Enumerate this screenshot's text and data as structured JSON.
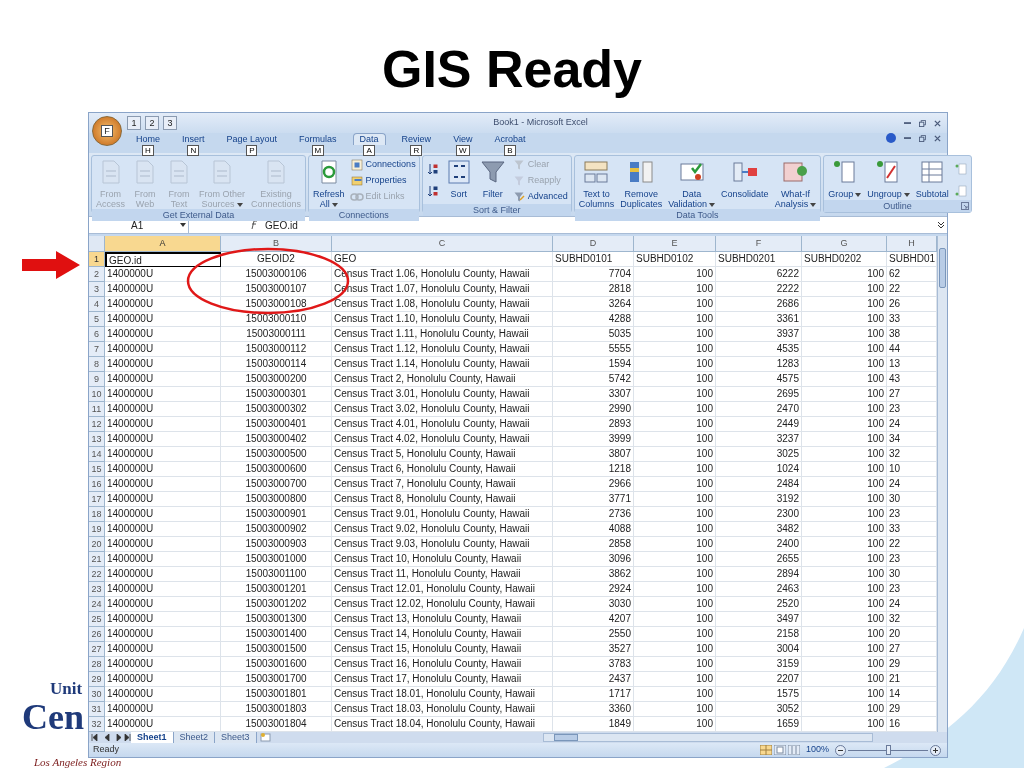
{
  "slide": {
    "title": "GIS Ready",
    "logo": {
      "line_1": "Unit",
      "line_2": "Cen",
      "region": "Los Angeles Region"
    }
  },
  "window": {
    "title": "Book1 - Microsoft Excel",
    "office_key": "F",
    "quick_access_keys": [
      "1",
      "2",
      "3"
    ]
  },
  "tabs": [
    {
      "label": "Home",
      "key": "H",
      "selected": false
    },
    {
      "label": "Insert",
      "key": "N",
      "selected": false
    },
    {
      "label": "Page Layout",
      "key": "P",
      "selected": false
    },
    {
      "label": "Formulas",
      "key": "M",
      "selected": false
    },
    {
      "label": "Data",
      "key": "A",
      "selected": true
    },
    {
      "label": "Review",
      "key": "R",
      "selected": false
    },
    {
      "label": "View",
      "key": "W",
      "selected": false
    },
    {
      "label": "Acrobat",
      "key": "B",
      "selected": false
    }
  ],
  "ribbon_groups": [
    {
      "name": "Get External Data",
      "launcher": false,
      "items": [
        {
          "kind": "large",
          "lines": [
            "From",
            "Access"
          ],
          "disabled": true,
          "caret": false
        },
        {
          "kind": "large",
          "lines": [
            "From",
            "Web"
          ],
          "disabled": true,
          "caret": false
        },
        {
          "kind": "large",
          "lines": [
            "From",
            "Text"
          ],
          "disabled": true,
          "caret": false
        },
        {
          "kind": "large",
          "lines": [
            "From Other",
            "Sources"
          ],
          "disabled": true,
          "caret": true
        },
        {
          "kind": "large",
          "lines": [
            "Existing",
            "Connections"
          ],
          "disabled": true,
          "caret": false
        }
      ]
    },
    {
      "name": "Connections",
      "launcher": false,
      "items": [
        {
          "kind": "large",
          "lines": [
            "Refresh",
            "All"
          ],
          "disabled": false,
          "caret": true
        },
        {
          "kind": "stack",
          "items": [
            {
              "label": "Connections",
              "disabled": false
            },
            {
              "label": "Properties",
              "disabled": false
            },
            {
              "label": "Edit Links",
              "disabled": true
            }
          ]
        }
      ]
    },
    {
      "name": "Sort & Filter",
      "launcher": false,
      "items": [
        {
          "kind": "iconstack"
        },
        {
          "kind": "large",
          "lines": [
            "Sort"
          ],
          "disabled": false,
          "caret": false
        },
        {
          "kind": "large",
          "lines": [
            "Filter"
          ],
          "disabled": false,
          "caret": false
        },
        {
          "kind": "stack",
          "items": [
            {
              "label": "Clear",
              "disabled": true
            },
            {
              "label": "Reapply",
              "disabled": true
            },
            {
              "label": "Advanced",
              "disabled": false
            }
          ]
        }
      ]
    },
    {
      "name": "Data Tools",
      "launcher": false,
      "items": [
        {
          "kind": "large",
          "lines": [
            "Text to",
            "Columns"
          ],
          "disabled": false,
          "caret": false
        },
        {
          "kind": "large",
          "lines": [
            "Remove",
            "Duplicates"
          ],
          "disabled": false,
          "caret": false
        },
        {
          "kind": "large",
          "lines": [
            "Data",
            "Validation"
          ],
          "disabled": false,
          "caret": true
        },
        {
          "kind": "large",
          "lines": [
            "Consolidate"
          ],
          "disabled": false,
          "caret": false
        },
        {
          "kind": "large",
          "lines": [
            "What-If",
            "Analysis"
          ],
          "disabled": false,
          "caret": true
        }
      ]
    },
    {
      "name": "Outline",
      "launcher": true,
      "items": [
        {
          "kind": "large",
          "lines": [
            "Group"
          ],
          "disabled": false,
          "caret": true
        },
        {
          "kind": "large",
          "lines": [
            "Ungroup"
          ],
          "disabled": false,
          "caret": true
        },
        {
          "kind": "large",
          "lines": [
            "Subtotal"
          ],
          "disabled": false,
          "caret": false
        },
        {
          "kind": "iconstack"
        }
      ]
    }
  ],
  "formula_bar": {
    "name_box": "A1",
    "formula": "GEO.id"
  },
  "columns": [
    {
      "letter": "A",
      "selected": true
    },
    {
      "letter": "B",
      "selected": false
    },
    {
      "letter": "C",
      "selected": false
    },
    {
      "letter": "D",
      "selected": false
    },
    {
      "letter": "E",
      "selected": false
    },
    {
      "letter": "F",
      "selected": false
    },
    {
      "letter": "G",
      "selected": false
    },
    {
      "letter": "H",
      "selected": false
    }
  ],
  "rows": [
    {
      "number": "1",
      "selected": true,
      "kind": "header",
      "cells": [
        "GEO.id",
        "GEOID2",
        "GEO",
        "SUBHD0101",
        "SUBHD0102",
        "SUBHD0201",
        "SUBHD0202",
        "SUBHD01"
      ]
    },
    {
      "number": "2",
      "selected": false,
      "kind": "data",
      "cells": [
        "1400000U",
        "15003000106",
        "Census Tract 1.06, Honolulu County, Hawaii",
        "7704",
        "100",
        "6222",
        "100",
        "62"
      ]
    },
    {
      "number": "3",
      "selected": false,
      "kind": "data",
      "cells": [
        "1400000U",
        "15003000107",
        "Census Tract 1.07, Honolulu County, Hawaii",
        "2818",
        "100",
        "2222",
        "100",
        "22"
      ]
    },
    {
      "number": "4",
      "selected": false,
      "kind": "data",
      "cells": [
        "1400000U",
        "15003000108",
        "Census Tract 1.08, Honolulu County, Hawaii",
        "3264",
        "100",
        "2686",
        "100",
        "26"
      ]
    },
    {
      "number": "5",
      "selected": false,
      "kind": "data",
      "cells": [
        "1400000U",
        "15003000110",
        "Census Tract 1.10, Honolulu County, Hawaii",
        "4288",
        "100",
        "3361",
        "100",
        "33"
      ]
    },
    {
      "number": "6",
      "selected": false,
      "kind": "data",
      "cells": [
        "1400000U",
        "15003000111",
        "Census Tract 1.11, Honolulu County, Hawaii",
        "5035",
        "100",
        "3937",
        "100",
        "38"
      ]
    },
    {
      "number": "7",
      "selected": false,
      "kind": "data",
      "cells": [
        "1400000U",
        "15003000112",
        "Census Tract 1.12, Honolulu County, Hawaii",
        "5555",
        "100",
        "4535",
        "100",
        "44"
      ]
    },
    {
      "number": "8",
      "selected": false,
      "kind": "data",
      "cells": [
        "1400000U",
        "15003000114",
        "Census Tract 1.14, Honolulu County, Hawaii",
        "1594",
        "100",
        "1283",
        "100",
        "13"
      ]
    },
    {
      "number": "9",
      "selected": false,
      "kind": "data",
      "cells": [
        "1400000U",
        "15003000200",
        "Census Tract 2, Honolulu County, Hawaii",
        "5742",
        "100",
        "4575",
        "100",
        "43"
      ]
    },
    {
      "number": "10",
      "selected": false,
      "kind": "data",
      "cells": [
        "1400000U",
        "15003000301",
        "Census Tract 3.01, Honolulu County, Hawaii",
        "3307",
        "100",
        "2695",
        "100",
        "27"
      ]
    },
    {
      "number": "11",
      "selected": false,
      "kind": "data",
      "cells": [
        "1400000U",
        "15003000302",
        "Census Tract 3.02, Honolulu County, Hawaii",
        "2990",
        "100",
        "2470",
        "100",
        "23"
      ]
    },
    {
      "number": "12",
      "selected": false,
      "kind": "data",
      "cells": [
        "1400000U",
        "15003000401",
        "Census Tract 4.01, Honolulu County, Hawaii",
        "2893",
        "100",
        "2449",
        "100",
        "24"
      ]
    },
    {
      "number": "13",
      "selected": false,
      "kind": "data",
      "cells": [
        "1400000U",
        "15003000402",
        "Census Tract 4.02, Honolulu County, Hawaii",
        "3999",
        "100",
        "3237",
        "100",
        "34"
      ]
    },
    {
      "number": "14",
      "selected": false,
      "kind": "data",
      "cells": [
        "1400000U",
        "15003000500",
        "Census Tract 5, Honolulu County, Hawaii",
        "3807",
        "100",
        "3025",
        "100",
        "32"
      ]
    },
    {
      "number": "15",
      "selected": false,
      "kind": "data",
      "cells": [
        "1400000U",
        "15003000600",
        "Census Tract 6, Honolulu County, Hawaii",
        "1218",
        "100",
        "1024",
        "100",
        "10"
      ]
    },
    {
      "number": "16",
      "selected": false,
      "kind": "data",
      "cells": [
        "1400000U",
        "15003000700",
        "Census Tract 7, Honolulu County, Hawaii",
        "2966",
        "100",
        "2484",
        "100",
        "24"
      ]
    },
    {
      "number": "17",
      "selected": false,
      "kind": "data",
      "cells": [
        "1400000U",
        "15003000800",
        "Census Tract 8, Honolulu County, Hawaii",
        "3771",
        "100",
        "3192",
        "100",
        "30"
      ]
    },
    {
      "number": "18",
      "selected": false,
      "kind": "data",
      "cells": [
        "1400000U",
        "15003000901",
        "Census Tract 9.01, Honolulu County, Hawaii",
        "2736",
        "100",
        "2300",
        "100",
        "23"
      ]
    },
    {
      "number": "19",
      "selected": false,
      "kind": "data",
      "cells": [
        "1400000U",
        "15003000902",
        "Census Tract 9.02, Honolulu County, Hawaii",
        "4088",
        "100",
        "3482",
        "100",
        "33"
      ]
    },
    {
      "number": "20",
      "selected": false,
      "kind": "data",
      "cells": [
        "1400000U",
        "15003000903",
        "Census Tract 9.03, Honolulu County, Hawaii",
        "2858",
        "100",
        "2400",
        "100",
        "22"
      ]
    },
    {
      "number": "21",
      "selected": false,
      "kind": "data",
      "cells": [
        "1400000U",
        "15003001000",
        "Census Tract 10, Honolulu County, Hawaii",
        "3096",
        "100",
        "2655",
        "100",
        "23"
      ]
    },
    {
      "number": "22",
      "selected": false,
      "kind": "data",
      "cells": [
        "1400000U",
        "15003001100",
        "Census Tract 11, Honolulu County, Hawaii",
        "3862",
        "100",
        "2894",
        "100",
        "30"
      ]
    },
    {
      "number": "23",
      "selected": false,
      "kind": "data",
      "cells": [
        "1400000U",
        "15003001201",
        "Census Tract 12.01, Honolulu County, Hawaii",
        "2924",
        "100",
        "2463",
        "100",
        "23"
      ]
    },
    {
      "number": "24",
      "selected": false,
      "kind": "data",
      "cells": [
        "1400000U",
        "15003001202",
        "Census Tract 12.02, Honolulu County, Hawaii",
        "3030",
        "100",
        "2520",
        "100",
        "24"
      ]
    },
    {
      "number": "25",
      "selected": false,
      "kind": "data",
      "cells": [
        "1400000U",
        "15003001300",
        "Census Tract 13, Honolulu County, Hawaii",
        "4207",
        "100",
        "3497",
        "100",
        "32"
      ]
    },
    {
      "number": "26",
      "selected": false,
      "kind": "data",
      "cells": [
        "1400000U",
        "15003001400",
        "Census Tract 14, Honolulu County, Hawaii",
        "2550",
        "100",
        "2158",
        "100",
        "20"
      ]
    },
    {
      "number": "27",
      "selected": false,
      "kind": "data",
      "cells": [
        "1400000U",
        "15003001500",
        "Census Tract 15, Honolulu County, Hawaii",
        "3527",
        "100",
        "3004",
        "100",
        "27"
      ]
    },
    {
      "number": "28",
      "selected": false,
      "kind": "data",
      "cells": [
        "1400000U",
        "15003001600",
        "Census Tract 16, Honolulu County, Hawaii",
        "3783",
        "100",
        "3159",
        "100",
        "29"
      ]
    },
    {
      "number": "29",
      "selected": false,
      "kind": "data",
      "cells": [
        "1400000U",
        "15003001700",
        "Census Tract 17, Honolulu County, Hawaii",
        "2437",
        "100",
        "2207",
        "100",
        "21"
      ]
    },
    {
      "number": "30",
      "selected": false,
      "kind": "data",
      "cells": [
        "1400000U",
        "15003001801",
        "Census Tract 18.01, Honolulu County, Hawaii",
        "1717",
        "100",
        "1575",
        "100",
        "14"
      ]
    },
    {
      "number": "31",
      "selected": false,
      "kind": "data",
      "cells": [
        "1400000U",
        "15003001803",
        "Census Tract 18.03, Honolulu County, Hawaii",
        "3360",
        "100",
        "3052",
        "100",
        "29"
      ]
    },
    {
      "number": "32",
      "selected": false,
      "kind": "data",
      "cells": [
        "1400000U",
        "15003001804",
        "Census Tract 18.04, Honolulu County, Hawaii",
        "1849",
        "100",
        "1659",
        "100",
        "16"
      ]
    }
  ],
  "sheet_tabs": [
    {
      "label": "Sheet1",
      "selected": true
    },
    {
      "label": "Sheet2",
      "selected": false
    },
    {
      "label": "Sheet3",
      "selected": false
    }
  ],
  "status_bar": {
    "status": "Ready",
    "zoom": "100%",
    "zoom_slider": {
      "level": 0.5
    }
  }
}
